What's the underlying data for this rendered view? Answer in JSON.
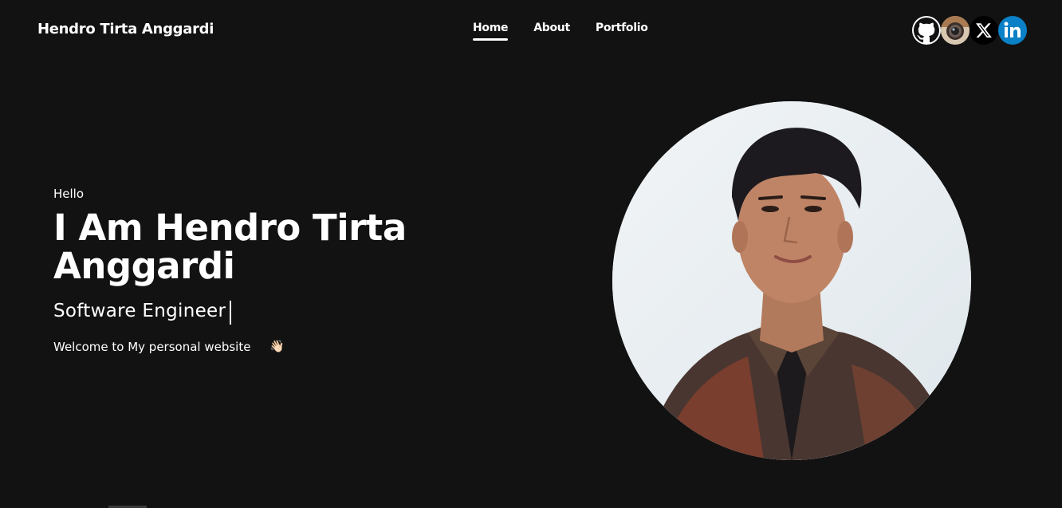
{
  "header": {
    "brand": "Hendro Tirta Anggardi",
    "nav": [
      {
        "label": "Home",
        "active": true
      },
      {
        "label": "About",
        "active": false
      },
      {
        "label": "Portfolio",
        "active": false
      }
    ],
    "socials": [
      {
        "name": "github-icon"
      },
      {
        "name": "instagram-icon"
      },
      {
        "name": "x-icon"
      },
      {
        "name": "linkedin-icon"
      }
    ]
  },
  "hero": {
    "greeting": "Hello",
    "headline": "I Am Hendro Tirta Anggardi",
    "role": "Software Engineer",
    "welcome": "Welcome to My personal website",
    "wave_emoji": "👋🏻"
  },
  "colors": {
    "background": "#121212",
    "text": "#ffffff",
    "linkedin": "#0a80c7"
  }
}
